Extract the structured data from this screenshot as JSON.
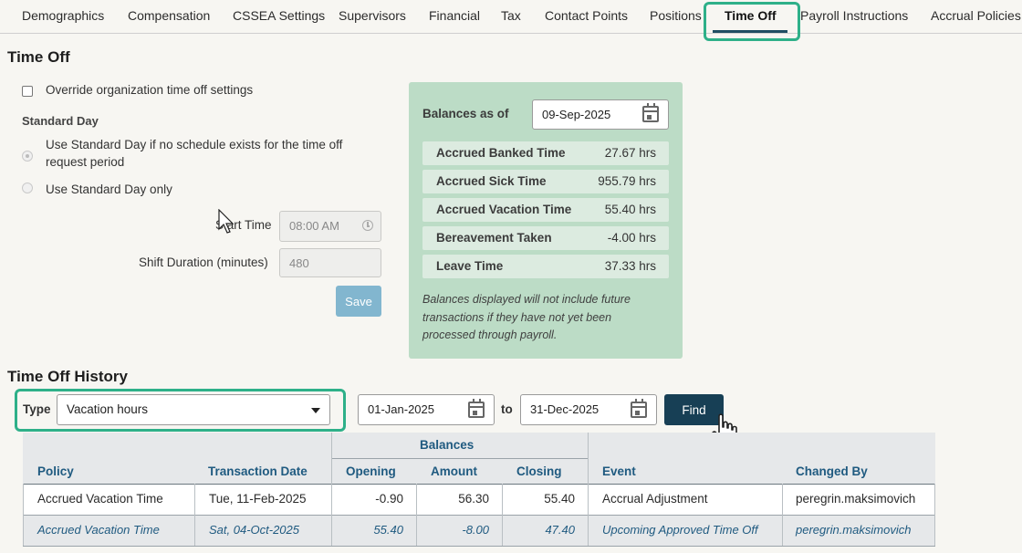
{
  "tabs": [
    {
      "label": "Demographics"
    },
    {
      "label": "Compensation"
    },
    {
      "label": "CSSEA Settings"
    },
    {
      "label": "Supervisors"
    },
    {
      "label": "Financial"
    },
    {
      "label": "Tax"
    },
    {
      "label": "Contact Points"
    },
    {
      "label": "Positions"
    },
    {
      "label": "Time Off",
      "active": true
    },
    {
      "label": "Payroll Instructions"
    },
    {
      "label": "Accrual Policies"
    }
  ],
  "time_off": {
    "title": "Time Off",
    "override_label": "Override organization time off settings",
    "standard_day_heading": "Standard Day",
    "radio_option_1_line1": "Use Standard Day if no schedule exists for the time off",
    "radio_option_1_line2": "request period",
    "radio_option_2": "Use Standard Day only",
    "start_time_label": "Start Time",
    "start_time_value": "08:00 AM",
    "shift_duration_label": "Shift Duration (minutes)",
    "shift_duration_value": "480",
    "save_label": "Save"
  },
  "balances": {
    "as_of_label": "Balances as of",
    "as_of_date": "09-Sep-2025",
    "rows": [
      {
        "name": "Accrued Banked Time",
        "value": "27.67 hrs"
      },
      {
        "name": "Accrued Sick Time",
        "value": "955.79 hrs"
      },
      {
        "name": "Accrued Vacation Time",
        "value": "55.40 hrs"
      },
      {
        "name": "Bereavement Taken",
        "value": "-4.00 hrs"
      },
      {
        "name": "Leave Time",
        "value": "37.33 hrs"
      }
    ],
    "note_line1": "Balances displayed will not include future",
    "note_line2": "transactions if they have not yet been",
    "note_line3": "processed through payroll."
  },
  "history": {
    "title": "Time Off History",
    "type_label": "Type",
    "type_value": "Vacation hours",
    "from_date": "01-Jan-2025",
    "to_label": "to",
    "to_date": "31-Dec-2025",
    "find_label": "Find",
    "table": {
      "group_header": "Balances",
      "columns": {
        "policy": "Policy",
        "transaction_date": "Transaction Date",
        "opening": "Opening",
        "amount": "Amount",
        "closing": "Closing",
        "event": "Event",
        "changed_by": "Changed By"
      },
      "rows": [
        {
          "policy": "Accrued Vacation Time",
          "date": "Tue, 11-Feb-2025",
          "opening": "-0.90",
          "amount": "56.30",
          "closing": "55.40",
          "event": "Accrual Adjustment",
          "changed_by": "peregrin.maksimovich"
        },
        {
          "policy": "Accrued Vacation Time",
          "date": "Sat, 04-Oct-2025",
          "opening": "55.40",
          "amount": "-8.00",
          "closing": "47.40",
          "event": "Upcoming Approved Time Off",
          "changed_by": "peregrin.maksimovich"
        }
      ]
    }
  },
  "colors": {
    "accent_highlight": "#2eb089",
    "panel_bg": "#bcdcc6",
    "find_button": "#173f55",
    "header_text": "#1f5a80"
  }
}
